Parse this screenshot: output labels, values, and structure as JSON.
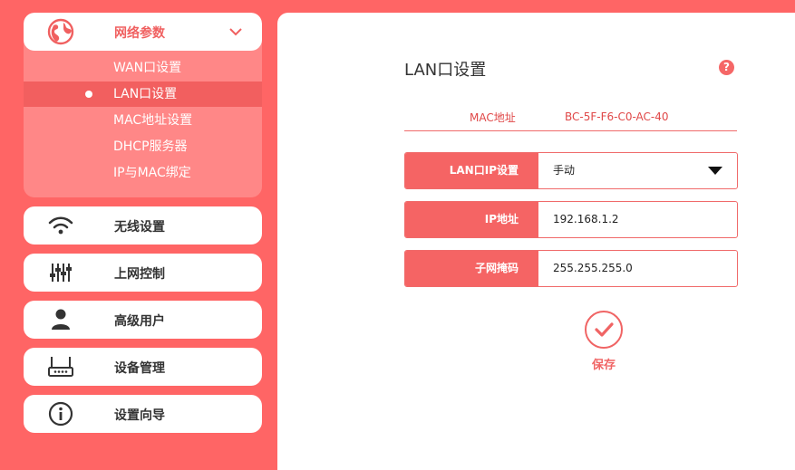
{
  "sidebar": {
    "network": {
      "label": "网络参数",
      "icon": "globe-icon",
      "items": [
        {
          "label": "WAN口设置"
        },
        {
          "label": "LAN口设置",
          "active": true
        },
        {
          "label": "MAC地址设置"
        },
        {
          "label": "DHCP服务器"
        },
        {
          "label": "IP与MAC绑定"
        }
      ]
    },
    "nav": [
      {
        "label": "无线设置",
        "icon": "wifi-icon"
      },
      {
        "label": "上网控制",
        "icon": "sliders-icon"
      },
      {
        "label": "高级用户",
        "icon": "user-icon"
      },
      {
        "label": "设备管理",
        "icon": "router-icon"
      },
      {
        "label": "设置向导",
        "icon": "info-icon"
      }
    ]
  },
  "main": {
    "title": "LAN口设置",
    "help_icon": "?",
    "mac": {
      "label": "MAC地址",
      "value": "BC-5F-F6-C0-AC-40"
    },
    "fields": [
      {
        "label": "LAN口IP设置",
        "value": "手动",
        "type": "select"
      },
      {
        "label": "IP地址",
        "value": "192.168.1.2",
        "type": "input"
      },
      {
        "label": "子网掩码",
        "value": "255.255.255.0",
        "type": "input"
      }
    ],
    "save_label": "保存"
  },
  "colors": {
    "accent": "#ff6565",
    "accent_light": "#ff8787",
    "active": "#f25f5f"
  }
}
